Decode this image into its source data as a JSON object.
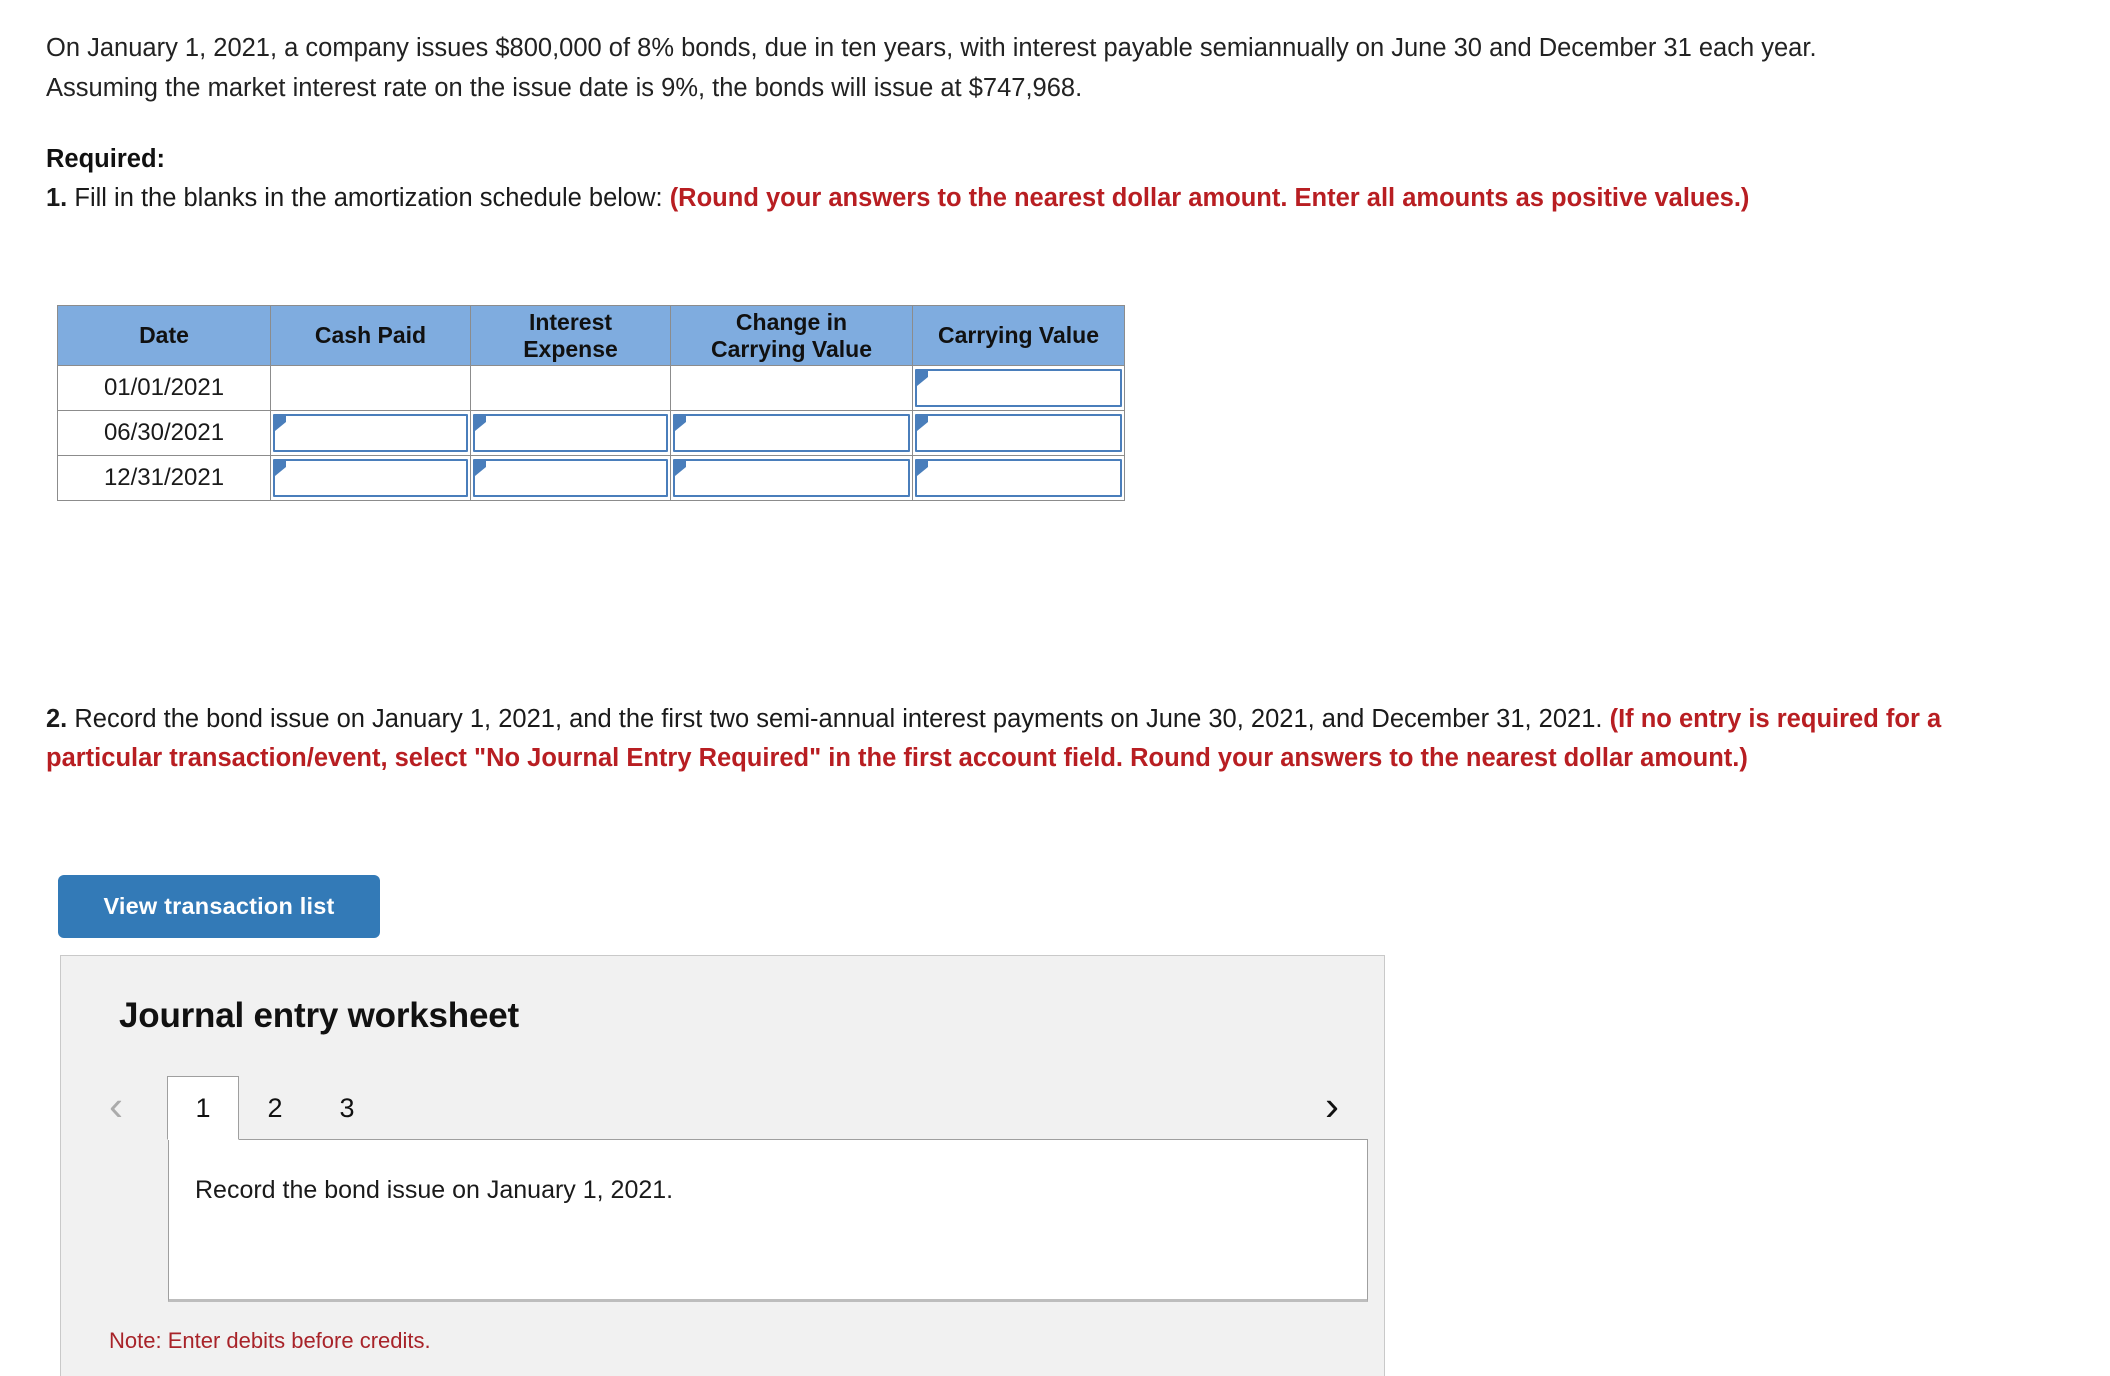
{
  "problem": {
    "intro": "On January 1, 2021, a company issues $800,000 of 8% bonds, due in ten years, with interest payable semiannually on June 30 and December 31 each year. Assuming the market interest rate on the issue date is 9%, the bonds will issue at $747,968."
  },
  "required": {
    "heading": "Required:",
    "item1_number": "1.",
    "item1_text": " Fill in the blanks in the amortization schedule below: ",
    "item1_emphasis": "(Round your answers to the nearest dollar amount. Enter all amounts as positive values.)",
    "item2_number": "2.",
    "item2_text": " Record the bond issue on January 1, 2021, and the first two semi-annual interest payments on June 30, 2021, and December 31, 2021. ",
    "item2_emphasis": "(If no entry is required for a particular transaction/event, select \"No Journal Entry Required\" in the first account field. Round your answers to the nearest dollar amount.)"
  },
  "amortization_table": {
    "headers": [
      "Date",
      "Cash Paid",
      "Interest Expense",
      "Change in Carrying Value",
      "Carrying Value"
    ],
    "header_lines": [
      [
        "Date"
      ],
      [
        "Cash Paid"
      ],
      [
        "Interest",
        "Expense"
      ],
      [
        "Change in",
        "Carrying Value"
      ],
      [
        "Carrying Value"
      ]
    ],
    "rows": [
      {
        "date": "01/01/2021",
        "cash_paid": "",
        "interest_expense": "",
        "change_in_carrying_value": "",
        "carrying_value": ""
      },
      {
        "date": "06/30/2021",
        "cash_paid": "",
        "interest_expense": "",
        "change_in_carrying_value": "",
        "carrying_value": ""
      },
      {
        "date": "12/31/2021",
        "cash_paid": "",
        "interest_expense": "",
        "change_in_carrying_value": "",
        "carrying_value": ""
      }
    ],
    "header_bg": "#7FACDF",
    "input_border": "#4A7EBB"
  },
  "toolbar": {
    "view_transaction_list_label": "View transaction list",
    "button_color": "#337AB7"
  },
  "journal_entry_worksheet": {
    "title": "Journal entry worksheet",
    "prev_arrow": "‹",
    "next_arrow": "›",
    "tabs": [
      {
        "label": "1",
        "active": true
      },
      {
        "label": "2",
        "active": false
      },
      {
        "label": "3",
        "active": false
      }
    ],
    "description": "Record the bond issue on January 1, 2021.",
    "note": "Note: Enter debits before credits.",
    "note_color": "#a82329"
  }
}
